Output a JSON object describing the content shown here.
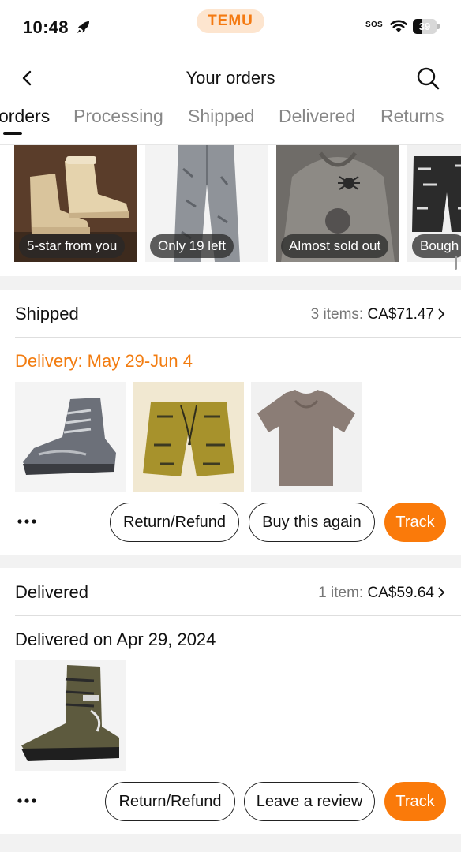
{
  "status_bar": {
    "time": "10:48",
    "brand": "TEMU",
    "sos": "SOS",
    "battery_level": "39",
    "battery_fraction": 0.39
  },
  "header": {
    "title": "Your orders"
  },
  "tabs": [
    {
      "label": "orders",
      "active": true
    },
    {
      "label": "Processing",
      "active": false
    },
    {
      "label": "Shipped",
      "active": false
    },
    {
      "label": "Delivered",
      "active": false
    },
    {
      "label": "Returns",
      "active": false
    }
  ],
  "strip": [
    {
      "badge": "5-star from you",
      "icon": "tan-boots"
    },
    {
      "badge": "Only 19 left",
      "icon": "grey-jeans"
    },
    {
      "badge": "Almost sold out",
      "icon": "spider-hoodie"
    },
    {
      "badge": "Bough",
      "icon": "bandana-shorts"
    }
  ],
  "orders": [
    {
      "status": "Shipped",
      "items_label": "3 items:",
      "total": "CA$71.47",
      "subtitle": "Delivery: May 29-Jun 4",
      "subtitle_color": "#f27c10",
      "items": [
        "grey-hiking-boot",
        "bandana-shorts",
        "brown-tshirt"
      ],
      "buttons": {
        "refund": "Return/Refund",
        "secondary": "Buy this again",
        "primary": "Track"
      }
    },
    {
      "status": "Delivered",
      "items_label": "1 item:",
      "total": "CA$59.64",
      "subtitle": "Delivered on Apr 29, 2024",
      "items": [
        "olive-combat-boot"
      ],
      "buttons": {
        "refund": "Return/Refund",
        "secondary": "Leave a review",
        "primary": "Track"
      }
    }
  ],
  "colors": {
    "accent": "#fa7a0a",
    "brand_pill": "#fde5cf",
    "delivery_text": "#f27c10"
  }
}
